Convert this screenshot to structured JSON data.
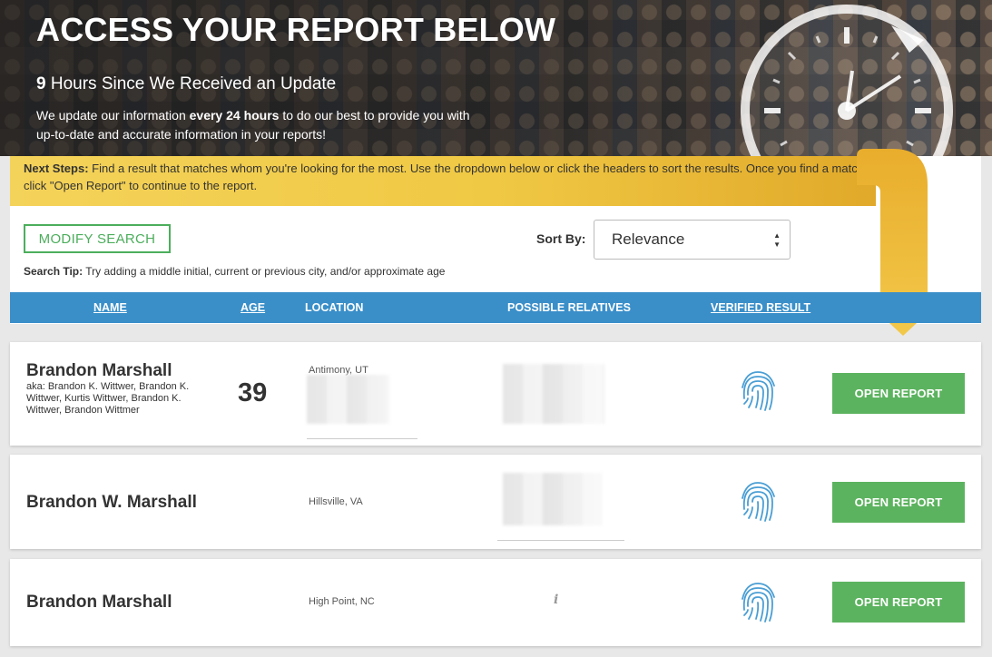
{
  "hero": {
    "title": "ACCESS YOUR REPORT BELOW",
    "update_count": "9",
    "update_text": " Hours Since We Received an Update",
    "desc_prefix": "We update our information ",
    "desc_bold": "every 24 hours",
    "desc_suffix": " to do our best to provide you with up-to-date and accurate information in your reports!"
  },
  "next_steps": {
    "label": "Next Steps:",
    "text": " Find a result that matches whom you're looking for the most. Use the dropdown below or click the headers to sort the results. Once you find a match, click \"Open Report\" to continue to the report."
  },
  "toolbar": {
    "modify_label": "MODIFY SEARCH",
    "tip_label": "Search Tip:",
    "tip_text": " Try adding a middle initial, current or previous city, and/or approximate age",
    "sort_label": "Sort By:",
    "sort_value": "Relevance"
  },
  "table": {
    "headers": {
      "name": "NAME",
      "age": "AGE",
      "location": "LOCATION",
      "relatives": "POSSIBLE RELATIVES",
      "verified": "VERIFIED RESULT"
    }
  },
  "results": [
    {
      "name": "Brandon Marshall",
      "aka": "aka: Brandon K. Wittwer, Brandon K. Wittwer, Kurtis Wittwer, Brandon K. Wittwer, Brandon Wittmer",
      "age": "39",
      "location": "Antimony, UT",
      "button": "OPEN REPORT"
    },
    {
      "name": "Brandon W. Marshall",
      "location": "Hillsville, VA",
      "button": "OPEN REPORT"
    },
    {
      "name": "Brandon Marshall",
      "location": "High Point, NC",
      "button": "OPEN REPORT"
    }
  ],
  "icons": {
    "clock": "clock-icon",
    "arrow": "arrow-down-icon",
    "fingerprint": "fingerprint-icon",
    "info": "info-icon",
    "sort": "sort-arrows-icon"
  },
  "colors": {
    "header_blue": "#3a8fc9",
    "button_green": "#5cb35f",
    "banner_yellow": "#f0c944",
    "fingerprint_blue": "#4a9ed4"
  }
}
